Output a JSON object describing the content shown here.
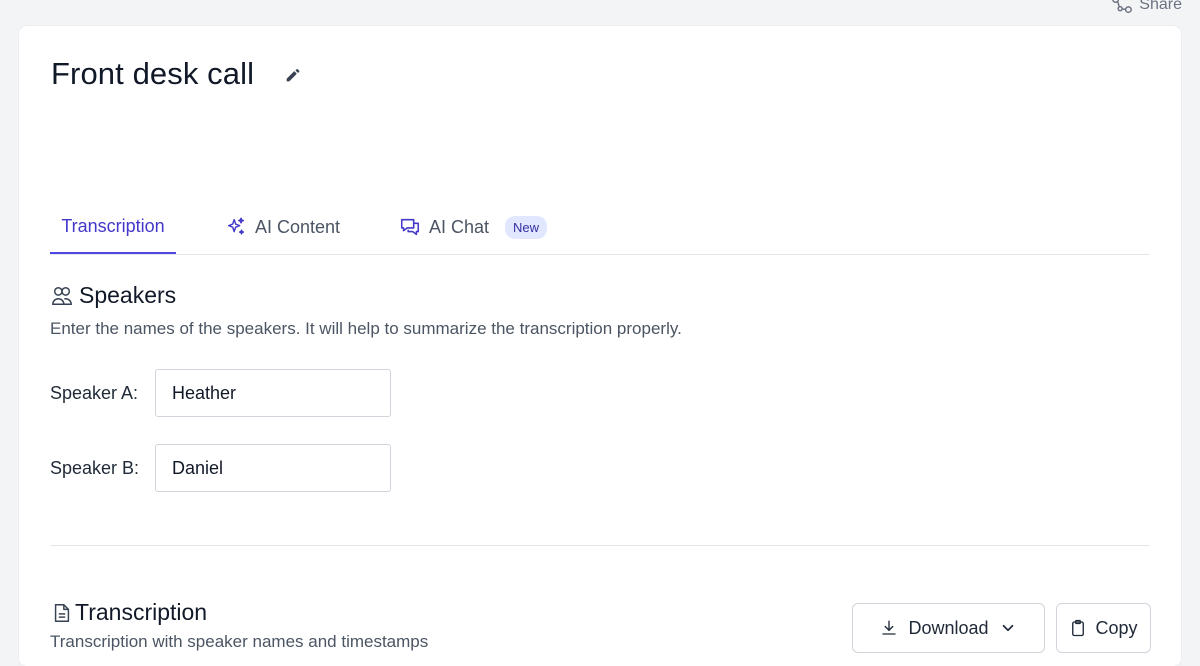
{
  "header": {
    "share_label": "Share",
    "share_icon": "share-icon"
  },
  "page": {
    "title": "Front desk call",
    "edit_icon": "pencil-icon"
  },
  "tabs": [
    {
      "label": "Transcription",
      "icon": "",
      "active": true
    },
    {
      "label": "AI Content",
      "icon": "sparkles-icon",
      "active": false
    },
    {
      "label": "AI Chat",
      "icon": "chat-icon",
      "active": false,
      "badge": "New"
    }
  ],
  "speakers": {
    "title": "Speakers",
    "icon": "users-icon",
    "description": "Enter the names of the speakers. It will help to summarize the transcription properly.",
    "fields": [
      {
        "label": "Speaker A:",
        "value": "Heather"
      },
      {
        "label": "Speaker B:",
        "value": "Daniel"
      }
    ]
  },
  "transcription": {
    "title": "Transcription",
    "icon": "document-icon",
    "description": "Transcription with speaker names and timestamps",
    "download_label": "Download",
    "copy_label": "Copy"
  },
  "colors": {
    "accent": "#4f46e5",
    "badge_bg": "#e0e7ff",
    "page_bg": "#f3f4f6"
  }
}
